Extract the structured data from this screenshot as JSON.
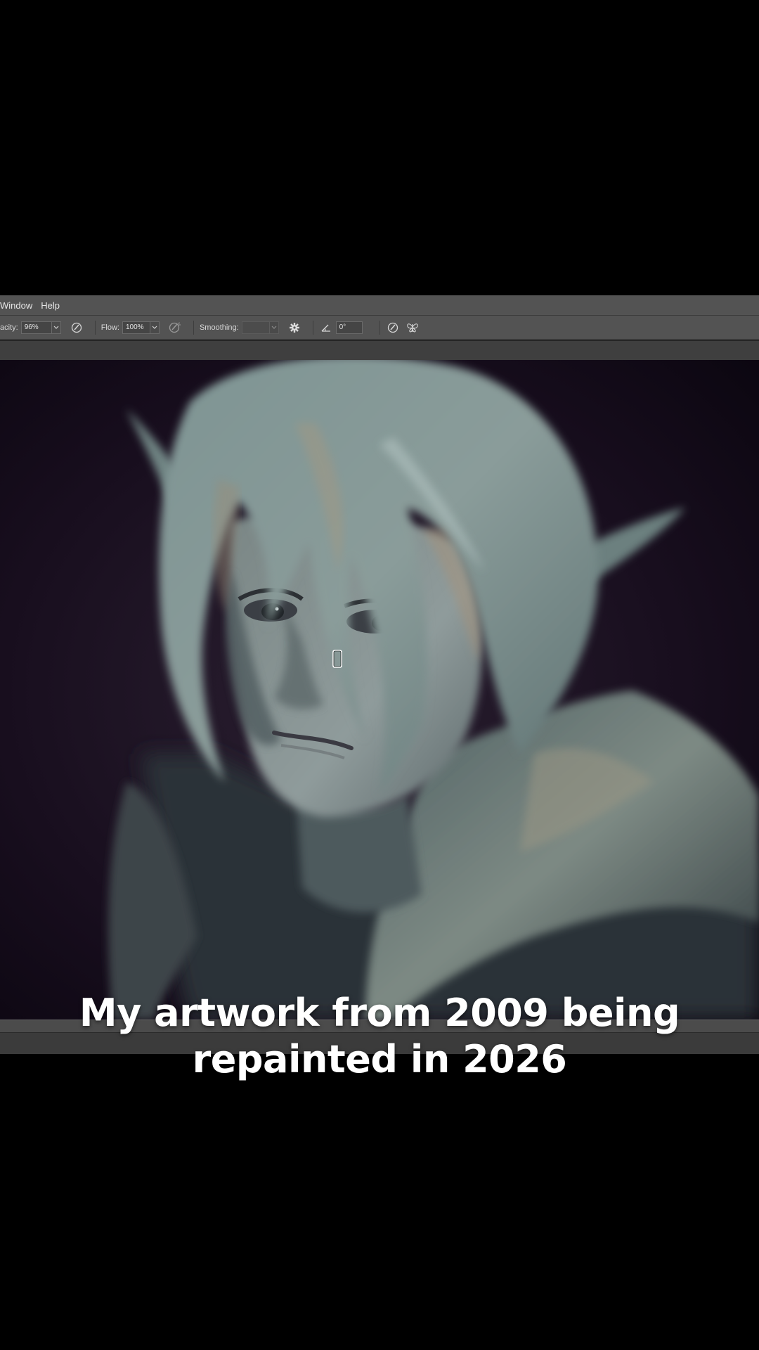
{
  "menubar": {
    "items": [
      "Window",
      "Help"
    ]
  },
  "options_bar": {
    "opacity_label": "acity:",
    "opacity_value": "96%",
    "flow_label": "Flow:",
    "flow_value": "100%",
    "smoothing_label": "Smoothing:",
    "smoothing_value": "",
    "angle_value": "0°"
  },
  "icons": [
    "airbrush-pressure-icon",
    "airbrush-icon",
    "gear-icon",
    "angle-icon",
    "pressure-size-icon",
    "symmetry-butterfly-icon",
    "brush-cursor-icon"
  ],
  "caption": {
    "line1": "My artwork from 2009 being",
    "line2": "repainted in 2026"
  },
  "colors": {
    "ui_bar": "#535353",
    "canvas_bg": "#140a1a",
    "hair": "#7b9190",
    "skin": "#8c9a9c"
  }
}
